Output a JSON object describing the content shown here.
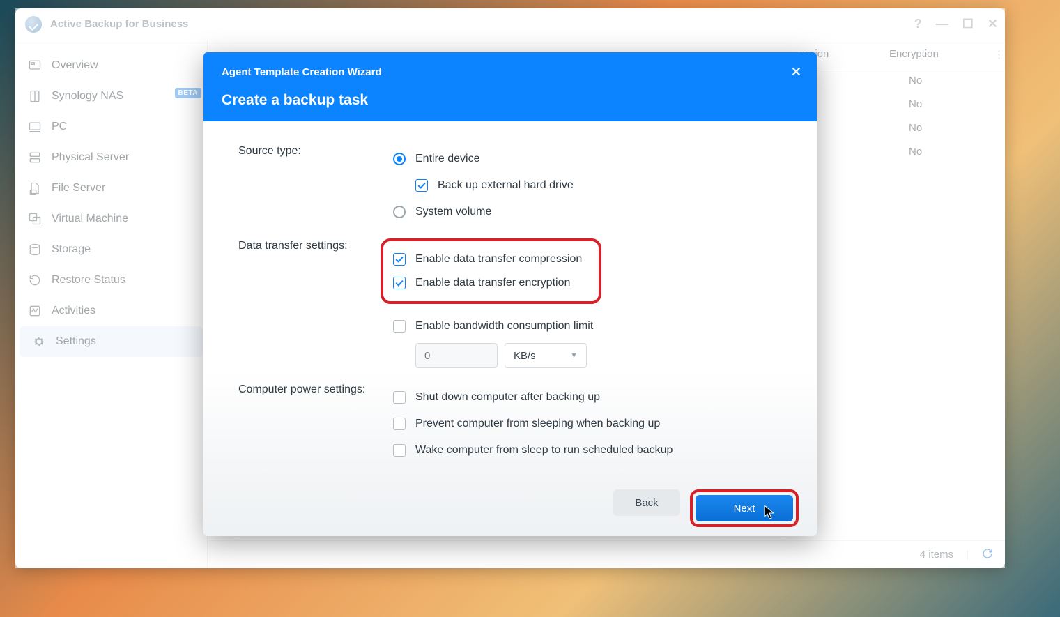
{
  "app_title": "Active Backup for Business",
  "sidebar": {
    "items": [
      {
        "label": "Overview"
      },
      {
        "label": "Synology NAS",
        "badge": "BETA"
      },
      {
        "label": "PC"
      },
      {
        "label": "Physical Server"
      },
      {
        "label": "File Server"
      },
      {
        "label": "Virtual Machine"
      },
      {
        "label": "Storage"
      },
      {
        "label": "Restore Status"
      },
      {
        "label": "Activities"
      },
      {
        "label": "Settings"
      }
    ]
  },
  "table": {
    "columns": {
      "compression": "ession",
      "encryption": "Encryption"
    },
    "rows": [
      {
        "compression": "",
        "encryption": "No"
      },
      {
        "compression": "",
        "encryption": "No"
      },
      {
        "compression": "",
        "encryption": "No"
      },
      {
        "compression": "",
        "encryption": "No"
      }
    ],
    "status_count": "4 items"
  },
  "modal": {
    "wizard_name": "Agent Template Creation Wizard",
    "title": "Create a backup task",
    "labels": {
      "source_type": "Source type:",
      "data_transfer": "Data transfer settings:",
      "power": "Computer power settings:"
    },
    "options": {
      "entire_device": "Entire device",
      "external_drive": "Back up external hard drive",
      "system_volume": "System volume",
      "compression": "Enable data transfer compression",
      "encryption": "Enable data transfer encryption",
      "bandwidth": "Enable bandwidth consumption limit",
      "bw_value": "0",
      "bw_unit": "KB/s",
      "shutdown": "Shut down computer after backing up",
      "prevent_sleep": "Prevent computer from sleeping when backing up",
      "wake": "Wake computer from sleep to run scheduled backup"
    },
    "buttons": {
      "back": "Back",
      "next": "Next"
    }
  }
}
